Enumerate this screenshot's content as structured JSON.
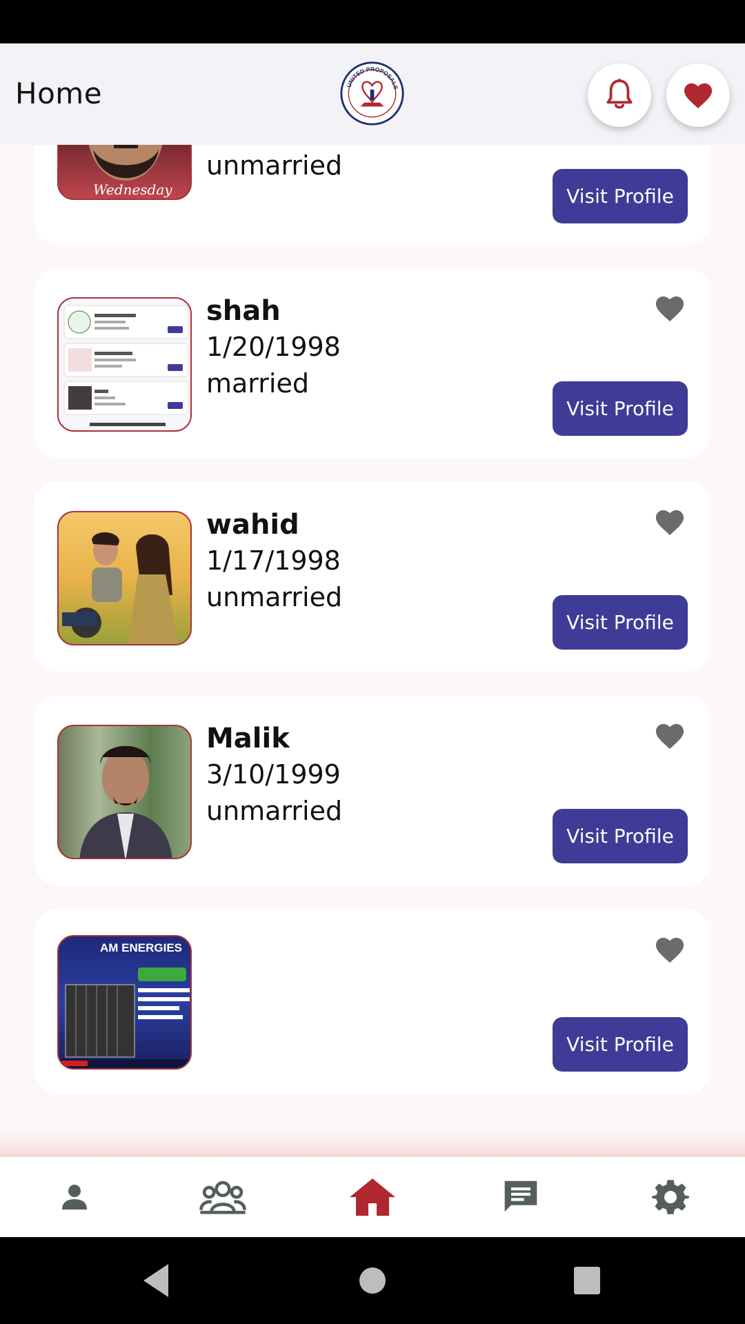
{
  "app_bar": {
    "title": "Home",
    "logo_text": "UNITED PROPOSALS",
    "notification_icon": "bell-icon",
    "favorites_icon": "heart-icon"
  },
  "colors": {
    "primary_button": "#3e3c96",
    "accent_red": "#b0282f",
    "favorite_icon_gray": "#6b6b6b",
    "nav_icon_gray": "#555f5a"
  },
  "profiles": [
    {
      "name": "",
      "dob": "",
      "status": "unmarried",
      "avatar_caption": "Wednesday",
      "button_label": "Visit Profile"
    },
    {
      "name": "shah",
      "dob": "1/20/1998",
      "status": "married",
      "button_label": "Visit Profile"
    },
    {
      "name": "wahid",
      "dob": "1/17/1998",
      "status": "unmarried",
      "button_label": "Visit Profile"
    },
    {
      "name": "Malik",
      "dob": "3/10/1999",
      "status": "unmarried",
      "button_label": "Visit Profile"
    },
    {
      "name": "",
      "dob": "",
      "status": "",
      "avatar_text": "AM ENERGIES",
      "button_label": "Visit Profile"
    }
  ],
  "bottom_nav": [
    {
      "icon": "person-icon",
      "active": false
    },
    {
      "icon": "group-icon",
      "active": false
    },
    {
      "icon": "home-icon",
      "active": true
    },
    {
      "icon": "chat-icon",
      "active": false
    },
    {
      "icon": "settings-icon",
      "active": false
    }
  ]
}
